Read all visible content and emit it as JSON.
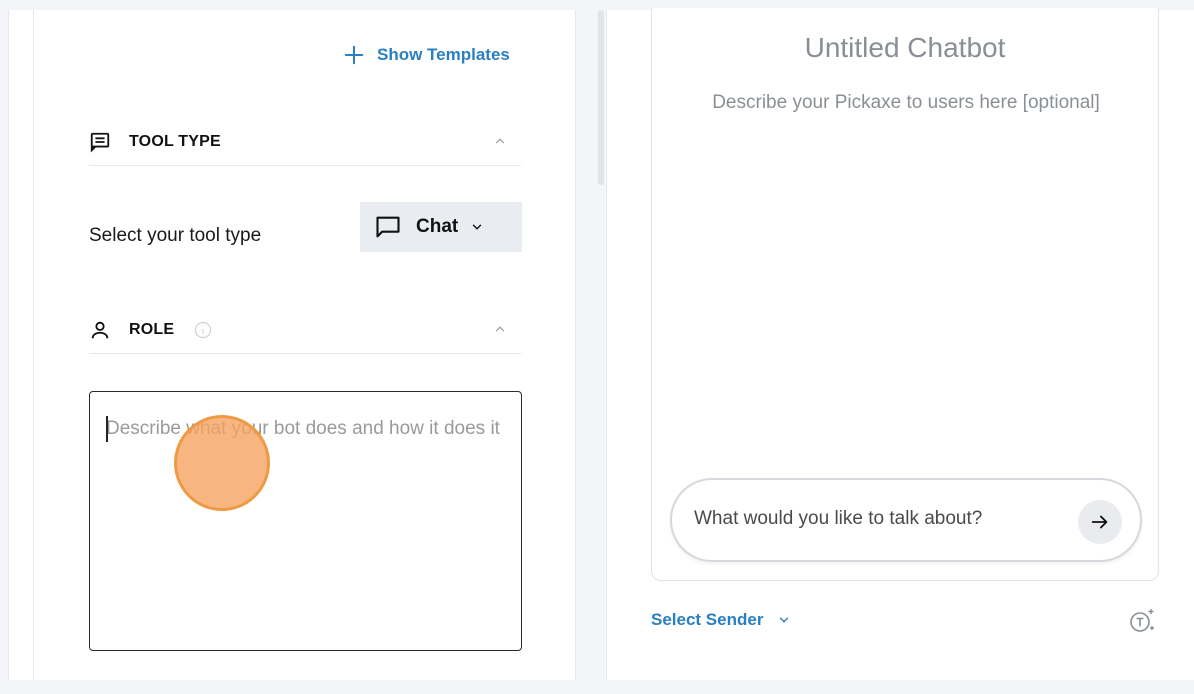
{
  "left": {
    "show_templates": "Show Templates",
    "tool_type": {
      "title": "TOOL TYPE",
      "row_label": "Select your tool type",
      "selected": "Chat"
    },
    "role": {
      "title": "ROLE",
      "placeholder": "Describe what your bot does and how it does it"
    }
  },
  "right": {
    "bot_title": "Untitled Chatbot",
    "bot_description": "Describe your Pickaxe to users here [optional]",
    "message_placeholder": "What would you like to talk about?",
    "select_sender": "Select Sender"
  },
  "colors": {
    "accent": "#2a7fc1",
    "click_marker": "#f7a260"
  }
}
